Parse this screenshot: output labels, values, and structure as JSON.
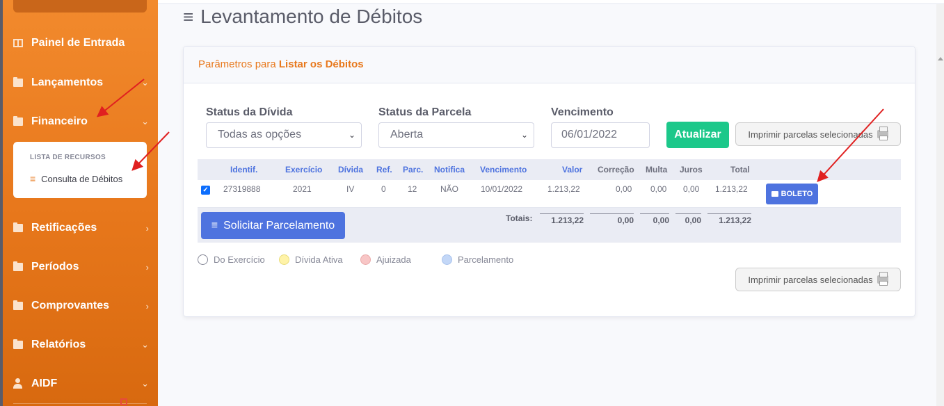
{
  "sidebar": {
    "items": [
      {
        "label": "Painel de Entrada",
        "icon": "panel-icon"
      },
      {
        "label": "Lançamentos",
        "icon": "folder-icon"
      },
      {
        "label": "Financeiro",
        "icon": "folder-icon"
      },
      {
        "label": "Retificações",
        "icon": "folder-icon"
      },
      {
        "label": "Períodos",
        "icon": "folder-icon"
      },
      {
        "label": "Comprovantes",
        "icon": "folder-icon"
      },
      {
        "label": "Relatórios",
        "icon": "folder-icon"
      },
      {
        "label": "AIDF",
        "icon": "user-icon"
      }
    ],
    "submenu": {
      "header": "LISTA DE RECURSOS",
      "link": "Consulta de Débitos"
    }
  },
  "page": {
    "title": "Levantamento de Débitos"
  },
  "card": {
    "title_prefix": "Parâmetros para ",
    "title_bold": "Listar os Débitos"
  },
  "filters": {
    "status_divida_label": "Status da Dívida",
    "status_divida_value": "Todas as opções",
    "status_parcela_label": "Status da Parcela",
    "status_parcela_value": "Aberta",
    "vencimento_label": "Vencimento",
    "vencimento_value": "06/01/2022",
    "atualizar_label": "Atualizar",
    "imprimir_label": "Imprimir parcelas selecionadas"
  },
  "table": {
    "headers": [
      "Identif.",
      "Exercício",
      "Dívida",
      "Ref.",
      "Parc.",
      "Notifica",
      "Vencimento",
      "Valor",
      "Correção",
      "Multa",
      "Juros",
      "Total"
    ],
    "rows": [
      {
        "checked": true,
        "identif": "27319888",
        "exercicio": "2021",
        "divida": "IV",
        "ref": "0",
        "parc": "12",
        "notifica": "NÃO",
        "vencimento": "10/01/2022",
        "valor": "1.213,22",
        "correcao": "0,00",
        "multa": "0,00",
        "juros": "0,00",
        "total": "1.213,22",
        "boleto_label": "BOLETO"
      }
    ],
    "totals_label": "Totais:",
    "totals": {
      "valor": "1.213,22",
      "correcao": "0,00",
      "multa": "0,00",
      "juros": "0,00",
      "total": "1.213,22"
    }
  },
  "actions": {
    "parcelamento_label": "Solicitar Parcelamento",
    "imprimir_bottom_label": "Imprimir parcelas selecionadas"
  },
  "legend": [
    {
      "label": "Do Exercício",
      "color": "#ffffff"
    },
    {
      "label": "Dívida Ativa",
      "color": "#fff3a8"
    },
    {
      "label": "Ajuizada",
      "color": "#f8c6c6"
    },
    {
      "label": "Parcelamento",
      "color": "#c3d7f7"
    }
  ],
  "colors": {
    "brand_orange": "#e8781c",
    "primary_blue": "#4e73df",
    "success_green": "#1cc88a",
    "annotation_red": "#e02020"
  }
}
